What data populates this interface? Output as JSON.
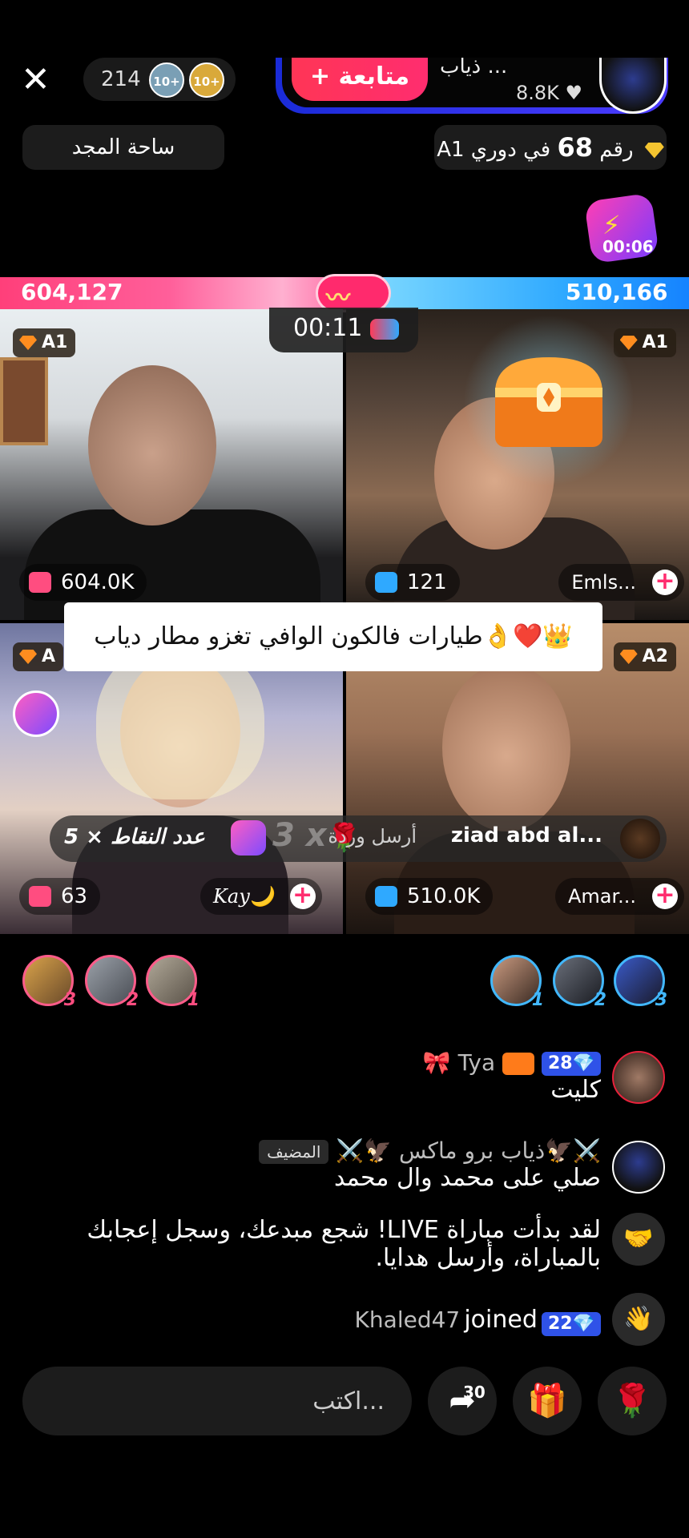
{
  "top_bar": {
    "close_icon": "✕",
    "viewer_count": "214",
    "rank_badge_1": "10+",
    "rank_badge_2": "10+",
    "follow_label": "+ متابعة",
    "host_name": "ذياب ...",
    "host_likes": "8.8K",
    "glory_label": "ساحة المجد",
    "league_prefix": "رقم",
    "league_number": "68",
    "league_suffix": "في دوري A1",
    "boost_timer": "00:06"
  },
  "battle": {
    "score_left": "604,127",
    "score_right": "510,166",
    "timer": "00:11"
  },
  "tiles": {
    "tl": {
      "league": "A1",
      "gifts": "604.0K"
    },
    "tr": {
      "league": "A1",
      "gifts": "121",
      "name": "Emls..."
    },
    "bl": {
      "league": "A",
      "gifts": "63",
      "name": "Kay🌙"
    },
    "br": {
      "league": "A2",
      "gifts": "510.0K",
      "name": "Amar..."
    }
  },
  "banner_text": "طيارات فالكون الوافي تغزو مطار دياب👌❤️👑",
  "gift_ticker": {
    "user": "ziad abd al...",
    "action": "أرسل وردة",
    "multiplier": "3 x",
    "points": "عدد النقاط × 5"
  },
  "gifters_left": [
    "3",
    "2",
    "1"
  ],
  "gifters_right": [
    "1",
    "2",
    "3"
  ],
  "chat": [
    {
      "name": "Tya 🎀",
      "level": "28",
      "message": "كليت"
    },
    {
      "name": "⚔️🦅ذياب برو ماكس 🦅⚔️",
      "tag": "المضيف",
      "message": "صلي على محمد وال محمد"
    },
    {
      "message_line1": "لقد بدأت مباراة LIVE! شجع مبدعك، وسجل إعجابك",
      "message_line2": "بالمباراة، وأرسل هدايا."
    },
    {
      "name": "Khaled47",
      "action": "joined",
      "level": "22"
    }
  ],
  "bottom_bar": {
    "input_placeholder": "اكتب...",
    "share_count": "30"
  },
  "colors": {
    "accent_pink": "#ff2d6f",
    "accent_blue": "#2fa9ff",
    "level_badge": "#2f52e8"
  }
}
